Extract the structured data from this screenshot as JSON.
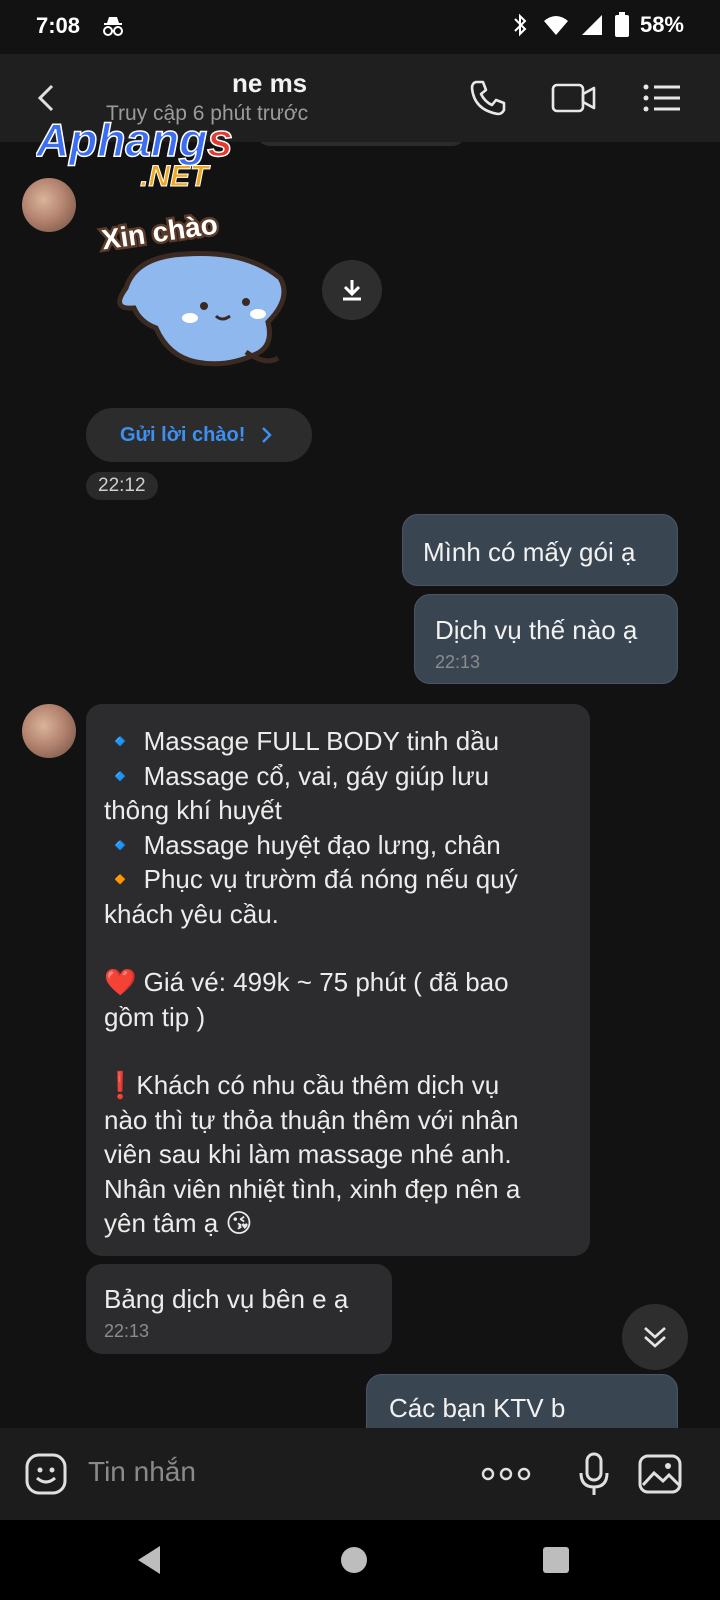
{
  "status_bar": {
    "time": "7:08",
    "battery": "58%"
  },
  "header": {
    "contact_name_visible": "ne ms",
    "contact_status": "Truy cập 6 phút trước",
    "watermark_text": "Aphang",
    "watermark_suffix": "s",
    "watermark_domain": ".NET"
  },
  "chat": {
    "sticker_caption": "Xin chào",
    "greet_button": "Gửi lời chào!",
    "time_1": "22:12",
    "out_messages": [
      {
        "text": "Mình có mấy gói ạ"
      },
      {
        "text": "Dịch vụ thế nào ạ",
        "time": "22:13"
      }
    ],
    "long_message": {
      "lines": [
        "🔹 Massage FULL BODY tinh dầu",
        "🔹 Massage cổ, vai, gáy giúp lưu",
        "thông khí huyết",
        "🔹 Massage huyệt đạo lưng, chân",
        "🔸 Phục vụ trườm đá nóng nếu quý",
        "khách yêu cầu.",
        "",
        "❤️ Giá vé:  499k ~ 75 phút ( đã bao",
        "gồm tip )",
        "",
        "❗Khách có nhu cầu thêm dịch vụ",
        "nào thì tự thỏa thuận thêm với nhân",
        "viên sau khi làm massage nhé anh.",
        "Nhân viên nhiệt tình, xinh đẹp nên a",
        "yên tâm ạ 😘"
      ]
    },
    "in_short": {
      "text": "Bảng dịch vụ bên e ạ",
      "time": "22:13"
    },
    "partial_out": "Các bạn KTV b"
  },
  "composer": {
    "placeholder": "Tin nhắn"
  },
  "icons": {
    "back": "back-arrow-icon",
    "call": "phone-icon",
    "video": "video-camera-icon",
    "menu": "list-menu-icon",
    "download": "download-icon",
    "scroll": "double-chevron-down-icon",
    "emoji": "emoji-icon",
    "more": "more-dots-icon",
    "mic": "microphone-icon",
    "image": "image-icon"
  },
  "colors": {
    "accent": "#3d8ff1",
    "out_bubble": "#3a4552",
    "in_bubble": "#2c2c2e",
    "background": "#121212"
  }
}
